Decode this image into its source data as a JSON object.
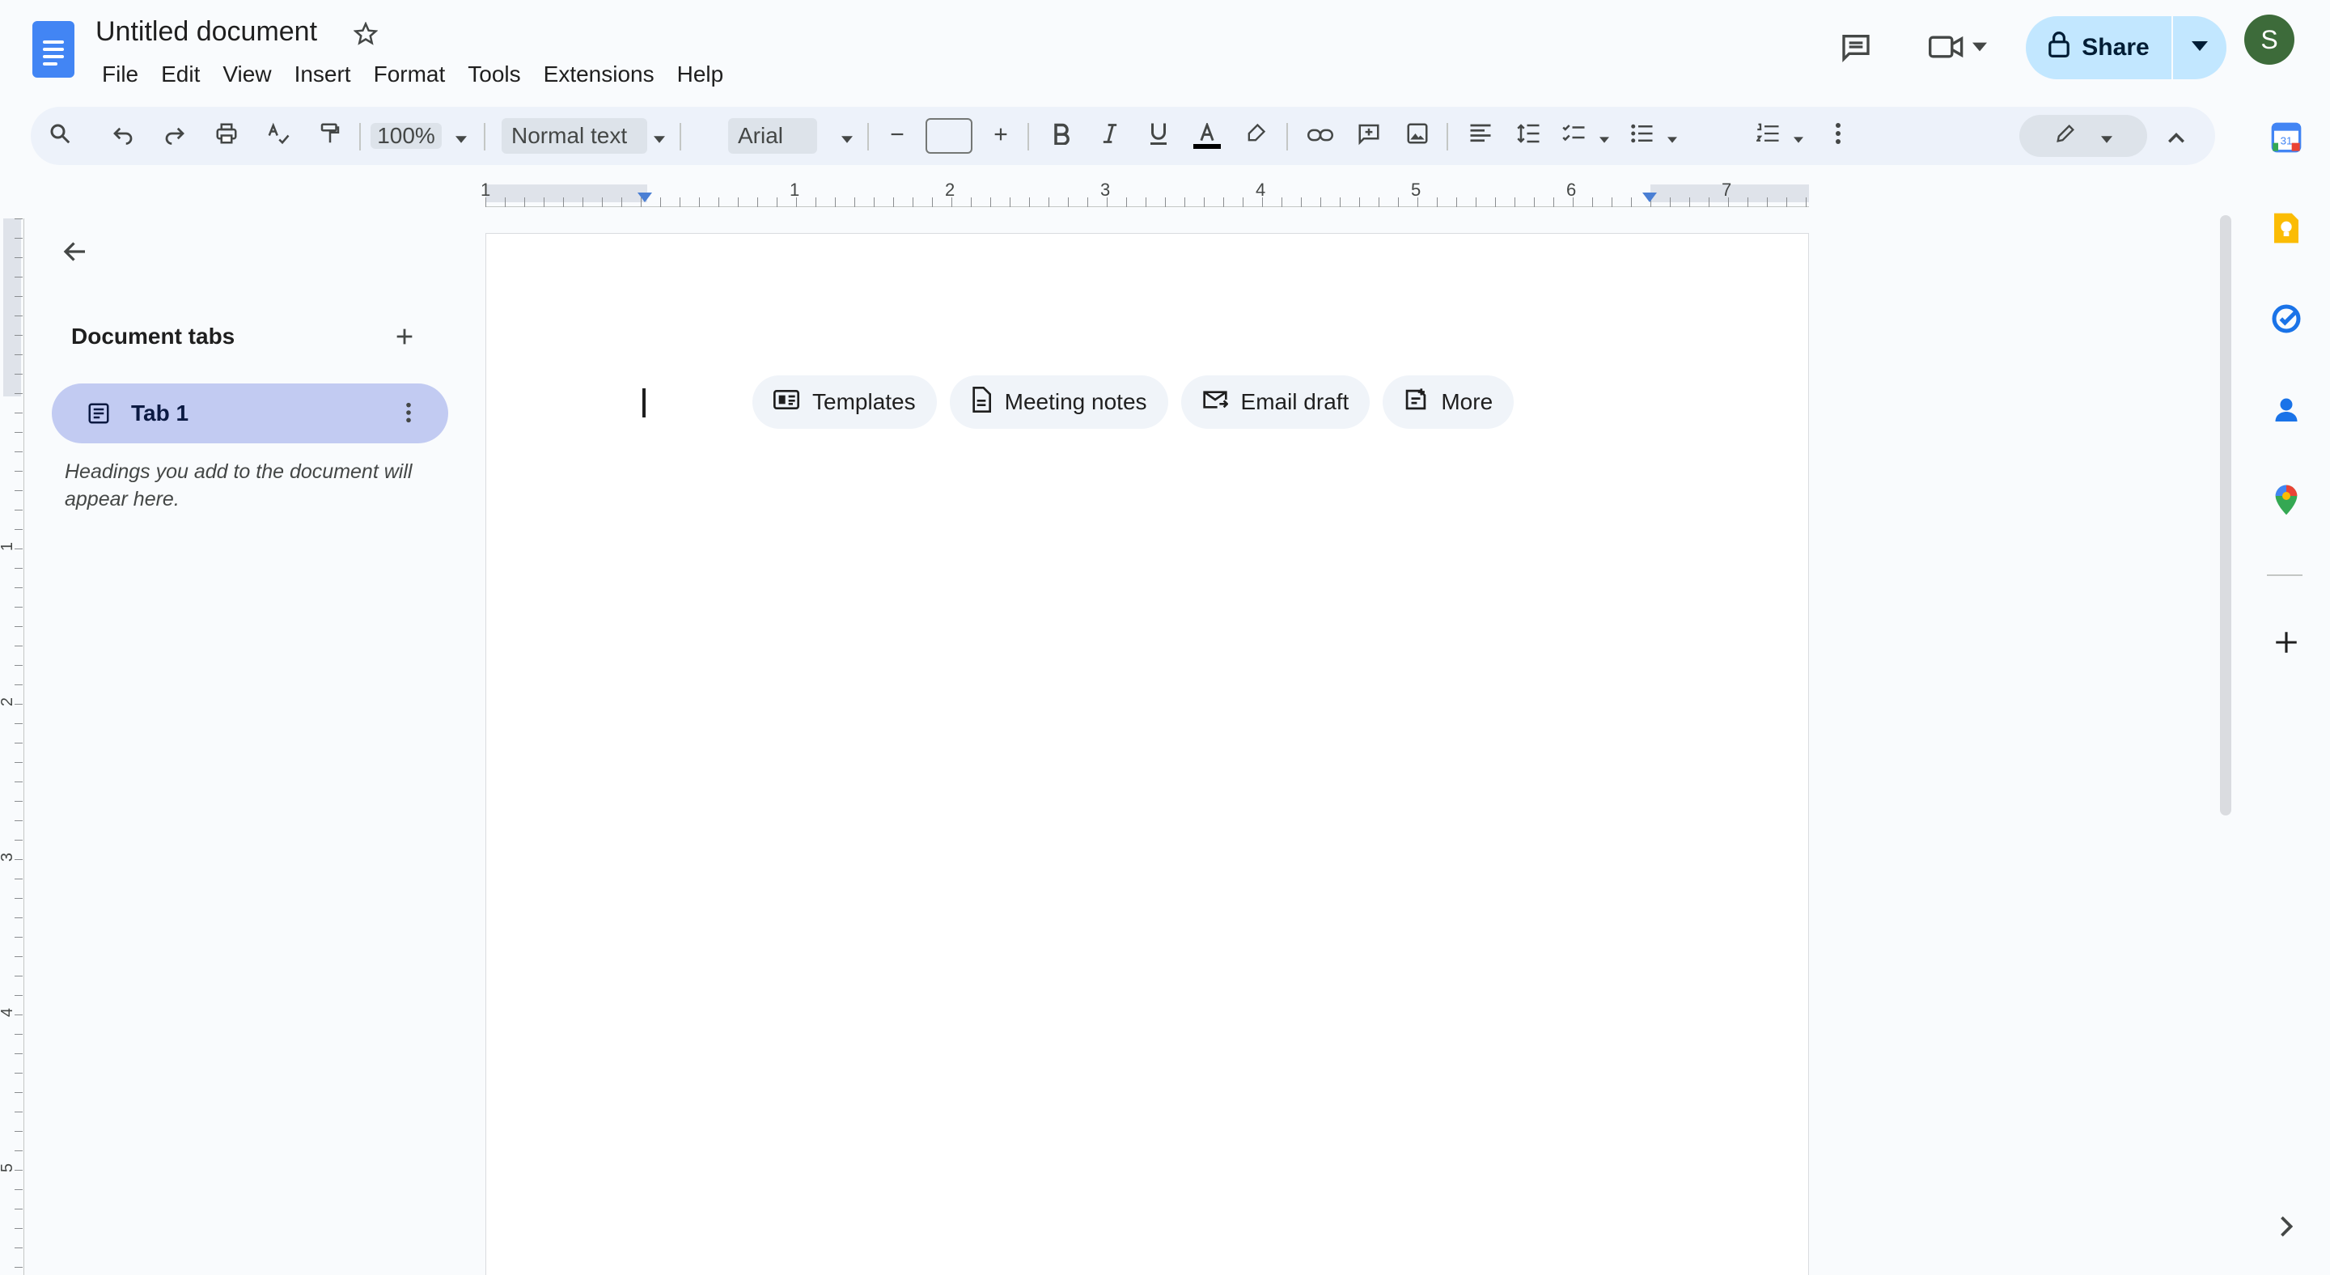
{
  "app": {
    "document_title": "Untitled document",
    "menu": [
      "File",
      "Edit",
      "View",
      "Insert",
      "Format",
      "Tools",
      "Extensions",
      "Help"
    ]
  },
  "header": {
    "share_label": "Share",
    "avatar_initial": "S"
  },
  "toolbar": {
    "zoom": "100%",
    "paragraph_style": "Normal text",
    "font": "Arial"
  },
  "ruler": {
    "horizontal_numbers": [
      "1",
      "1",
      "2",
      "3",
      "4",
      "5",
      "6",
      "7"
    ],
    "vertical_numbers": [
      "1",
      "2",
      "3",
      "4",
      "5"
    ]
  },
  "outline": {
    "title": "Document tabs",
    "tab_label": "Tab 1",
    "hint": "Headings you add to the document will appear here."
  },
  "document": {
    "chips": [
      {
        "label": "Templates",
        "icon": "template-icon"
      },
      {
        "label": "Meeting notes",
        "icon": "document-icon"
      },
      {
        "label": "Email draft",
        "icon": "email-draft-icon"
      },
      {
        "label": "More",
        "icon": "more-building-blocks-icon"
      }
    ]
  },
  "side_panel": {
    "apps": [
      "calendar-icon",
      "keep-icon",
      "tasks-icon",
      "contacts-icon",
      "maps-icon",
      "add-icon"
    ]
  },
  "colors": {
    "brand_blue": "#4285f4",
    "share_bg": "#c2e7ff",
    "toolbar_bg": "#edf2fa",
    "tab_selected": "#c2cbf2"
  }
}
